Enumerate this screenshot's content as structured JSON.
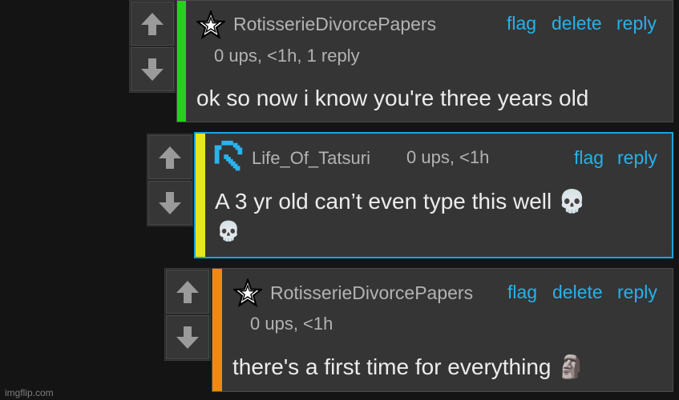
{
  "comments": [
    {
      "username": "RotisserieDivorcePapers",
      "meta": "0 ups, <1h, 1 reply",
      "body": "ok so now i know you're three years old",
      "actions": {
        "flag": "flag",
        "delete": "delete",
        "reply": "reply"
      },
      "bar_color": "#27d01c",
      "avatar_icon": "star-icon"
    },
    {
      "username": "Life_Of_Tatsuri",
      "meta": "0 ups, <1h",
      "body_line1": "A 3 yr old can’t even type this well 💀",
      "body_line2": "💀",
      "actions": {
        "flag": "flag",
        "reply": "reply"
      },
      "bar_color": "#e5e81c",
      "avatar_icon": "pickaxe-icon"
    },
    {
      "username": "RotisserieDivorcePapers",
      "meta": "0 ups, <1h",
      "body": "there's a first time for everything 🗿",
      "actions": {
        "flag": "flag",
        "delete": "delete",
        "reply": "reply"
      },
      "bar_color": "#f3890c",
      "avatar_icon": "star-icon"
    }
  ],
  "watermark": "imgflip.com",
  "colors": {
    "link": "#25b2ea",
    "selected_border": "#1aa5dc",
    "background": "#141414"
  }
}
